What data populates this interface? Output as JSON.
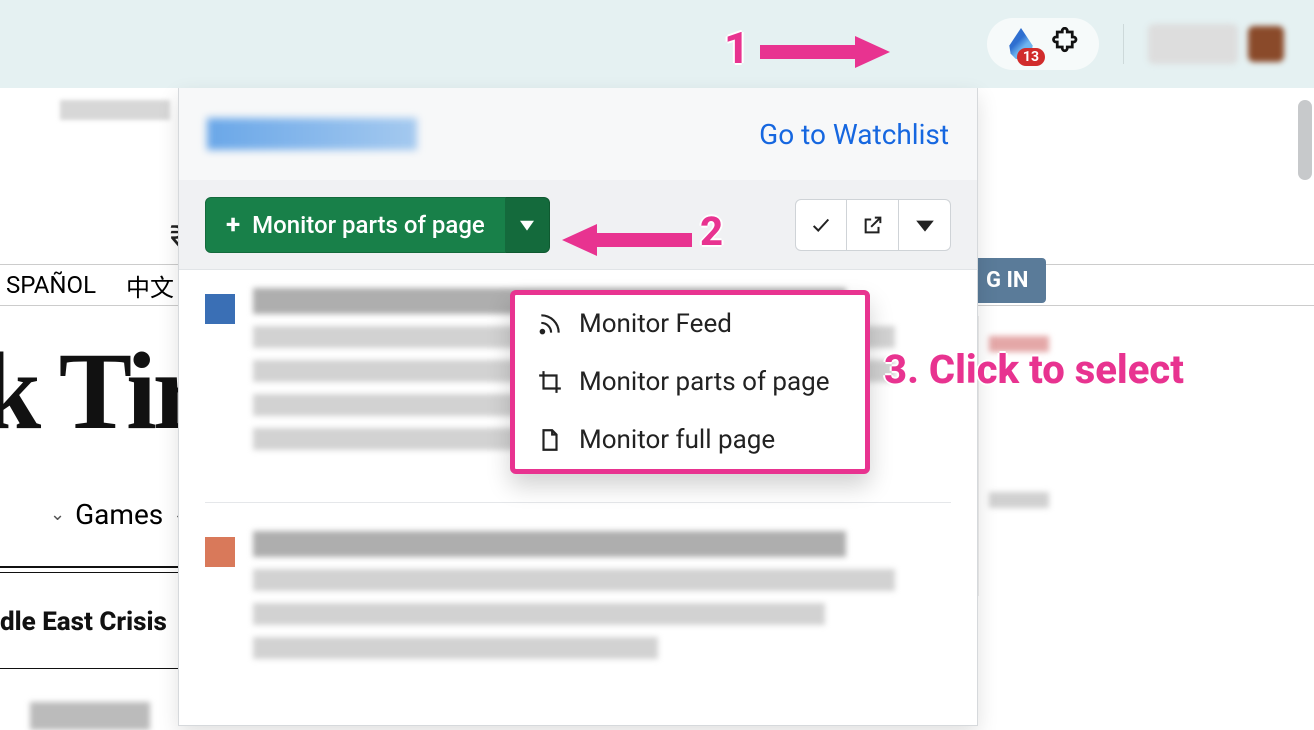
{
  "toolbar": {
    "extension_badge": "13"
  },
  "page": {
    "currency_symbol": "₹",
    "lang_items": [
      "SPAÑOL",
      "中文"
    ],
    "logo_fragment": "k Tir",
    "nav_item": "Games",
    "headline_fragment": "dle East Crisis",
    "login_fragment": "G IN"
  },
  "popup": {
    "watchlist_link": "Go to Watchlist",
    "monitor_button": "Monitor parts of page",
    "dropdown": {
      "items": [
        {
          "icon": "rss",
          "label": "Monitor Feed"
        },
        {
          "icon": "crop",
          "label": "Monitor parts of page"
        },
        {
          "icon": "file",
          "label": "Monitor full page"
        }
      ]
    }
  },
  "annotations": {
    "step1": "1",
    "step2": "2",
    "step3": "3. Click to select"
  }
}
